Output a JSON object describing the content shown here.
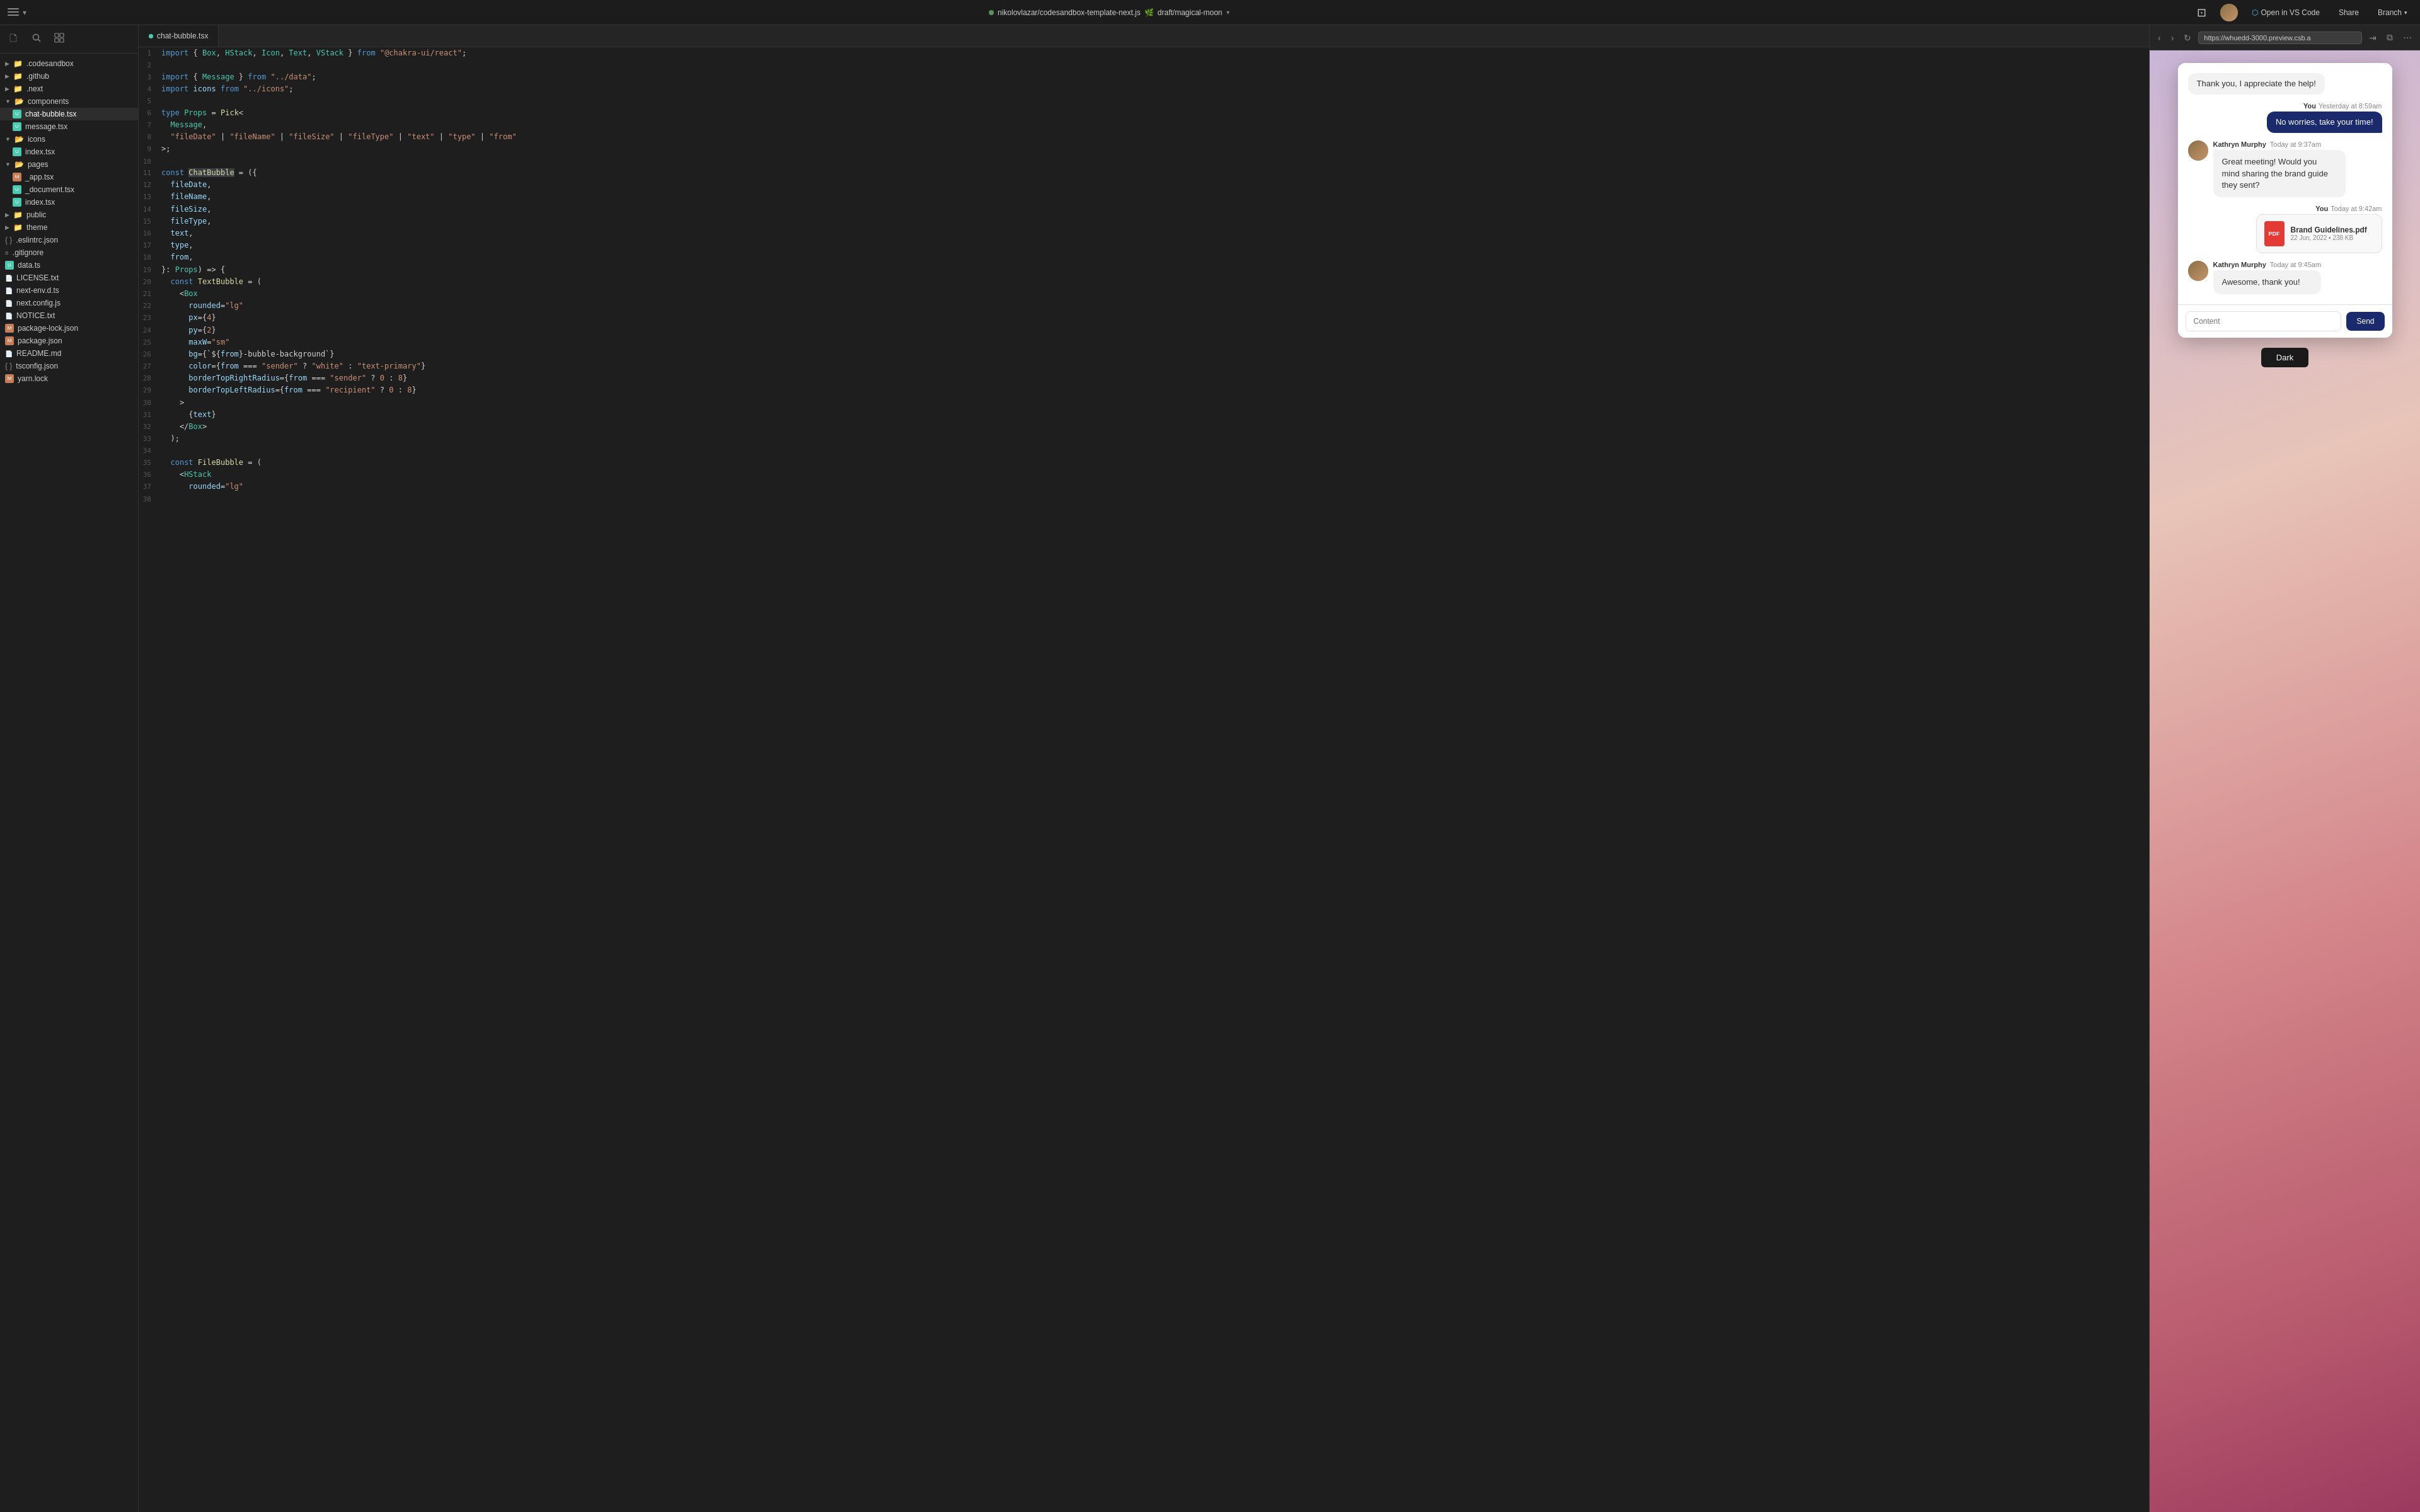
{
  "topbar": {
    "file_name": "nikolovlazar/codesandbox-template-next.js",
    "branch_separator": "🌿",
    "branch_name": "draft/magical-moon",
    "open_vscode_label": "Open in VS Code",
    "share_label": "Share",
    "branch_label": "Branch"
  },
  "sidebar": {
    "items": [
      {
        "id": "codesandbox",
        "label": ".codesandbox",
        "type": "folder",
        "indent": 0
      },
      {
        "id": "github",
        "label": ".github",
        "type": "folder",
        "indent": 0
      },
      {
        "id": "next",
        "label": ".next",
        "type": "folder",
        "indent": 0
      },
      {
        "id": "components",
        "label": "components",
        "type": "folder",
        "indent": 0
      },
      {
        "id": "chat-bubble",
        "label": "chat-bubble.tsx",
        "type": "file-ts",
        "indent": 1
      },
      {
        "id": "message",
        "label": "message.tsx",
        "type": "file-ts",
        "indent": 1
      },
      {
        "id": "icons",
        "label": "icons",
        "type": "folder",
        "indent": 0
      },
      {
        "id": "icons-index",
        "label": "index.tsx",
        "type": "file-ts",
        "indent": 1
      },
      {
        "id": "pages",
        "label": "pages",
        "type": "folder",
        "indent": 0
      },
      {
        "id": "_app",
        "label": "_app.tsx",
        "type": "file-m",
        "indent": 1
      },
      {
        "id": "_document",
        "label": "_document.tsx",
        "type": "file-ts",
        "indent": 1
      },
      {
        "id": "pages-index",
        "label": "index.tsx",
        "type": "file-ts",
        "indent": 1
      },
      {
        "id": "public",
        "label": "public",
        "type": "folder",
        "indent": 0
      },
      {
        "id": "theme",
        "label": "theme",
        "type": "folder",
        "indent": 0
      },
      {
        "id": "eslintrc",
        "label": ".eslintrc.json",
        "type": "file-json",
        "indent": 0
      },
      {
        "id": "gitignore",
        "label": ".gitignore",
        "type": "file-git",
        "indent": 0
      },
      {
        "id": "data",
        "label": "data.ts",
        "type": "file-ts",
        "indent": 0
      },
      {
        "id": "license",
        "label": "LICENSE.txt",
        "type": "file-txt",
        "indent": 0
      },
      {
        "id": "next-env",
        "label": "next-env.d.ts",
        "type": "file-ts",
        "indent": 0
      },
      {
        "id": "next-config",
        "label": "next.config.js",
        "type": "file-js",
        "indent": 0
      },
      {
        "id": "notice",
        "label": "NOTICE.txt",
        "type": "file-txt",
        "indent": 0
      },
      {
        "id": "package-lock",
        "label": "package-lock.json",
        "type": "file-m",
        "indent": 0
      },
      {
        "id": "package",
        "label": "package.json",
        "type": "file-m",
        "indent": 0
      },
      {
        "id": "readme",
        "label": "README.md",
        "type": "file-md",
        "indent": 0
      },
      {
        "id": "tsconfig",
        "label": "tsconfig.json",
        "type": "file-json",
        "indent": 0
      },
      {
        "id": "yarn-lock",
        "label": "yarn.lock",
        "type": "file-m",
        "indent": 0
      }
    ]
  },
  "editor": {
    "tab_name": "chat-bubble.tsx",
    "lines": [
      {
        "num": 1,
        "code": "import { Box, HStack, Icon, Text, VStack } from \"@chakra-ui/react\";"
      },
      {
        "num": 2,
        "code": ""
      },
      {
        "num": 3,
        "code": "import { Message } from \"../data\";"
      },
      {
        "num": 4,
        "code": "import icons from \"../icons\";"
      },
      {
        "num": 5,
        "code": ""
      },
      {
        "num": 6,
        "code": "type Props = Pick<"
      },
      {
        "num": 7,
        "code": "  Message,"
      },
      {
        "num": 8,
        "code": "  \"fileDate\" | \"fileName\" | \"fileSize\" | \"fileType\" | \"text\" | \"type\" | \"from\""
      },
      {
        "num": 9,
        "code": ">;"
      },
      {
        "num": 10,
        "code": ""
      },
      {
        "num": 11,
        "code": "const ChatBubble = ({"
      },
      {
        "num": 12,
        "code": "  fileDate,"
      },
      {
        "num": 13,
        "code": "  fileName,"
      },
      {
        "num": 14,
        "code": "  fileSize,"
      },
      {
        "num": 15,
        "code": "  fileType,"
      },
      {
        "num": 16,
        "code": "  text,"
      },
      {
        "num": 17,
        "code": "  type,"
      },
      {
        "num": 18,
        "code": "  from,"
      },
      {
        "num": 19,
        "code": "}: Props) => {"
      },
      {
        "num": 20,
        "code": "  const TextBubble = ("
      },
      {
        "num": 21,
        "code": "    <Box"
      },
      {
        "num": 22,
        "code": "      rounded=\"lg\""
      },
      {
        "num": 23,
        "code": "      px={4}"
      },
      {
        "num": 24,
        "code": "      py={2}"
      },
      {
        "num": 25,
        "code": "      maxW=\"sm\""
      },
      {
        "num": 26,
        "code": "      bg={`${from}-bubble-background`}"
      },
      {
        "num": 27,
        "code": "      color={from === \"sender\" ? \"white\" : \"text-primary\"}"
      },
      {
        "num": 28,
        "code": "      borderTopRightRadius={from === \"sender\" ? 0 : 8}"
      },
      {
        "num": 29,
        "code": "      borderTopLeftRadius={from === \"recipient\" ? 0 : 8}"
      },
      {
        "num": 30,
        "code": "    >"
      },
      {
        "num": 31,
        "code": "      {text}"
      },
      {
        "num": 32,
        "code": "    </Box>"
      },
      {
        "num": 33,
        "code": "  );"
      },
      {
        "num": 34,
        "code": ""
      },
      {
        "num": 35,
        "code": "  const FileBubble = ("
      },
      {
        "num": 36,
        "code": "    <HStack"
      },
      {
        "num": 37,
        "code": "      rounded=\"lg\""
      },
      {
        "num": 38,
        "code": ""
      }
    ]
  },
  "preview": {
    "url": "https://whuedd-3000.preview.csb.a",
    "chat": {
      "messages": [
        {
          "id": 1,
          "type": "received-no-avatar",
          "text": "Thank you, I appreciate the help!"
        },
        {
          "id": 2,
          "sender": "You",
          "time": "Yesterday at 8:59am",
          "type": "sent",
          "text": "No worries, take your time!"
        },
        {
          "id": 3,
          "sender": "Kathryn Murphy",
          "time": "Today at 9:37am",
          "type": "received",
          "text": "Great meeting! Would you mind sharing the brand guide they sent?"
        },
        {
          "id": 4,
          "sender": "You",
          "time": "Today at 9:42am",
          "type": "sent-file",
          "file_name": "Brand Guidelines.pdf",
          "file_meta": "22 Jun, 2022 • 238 KB"
        },
        {
          "id": 5,
          "sender": "Kathryn Murphy",
          "time": "Today at 9:45am",
          "type": "received",
          "text": "Awesome, thank you!"
        }
      ],
      "input_placeholder": "Content",
      "send_label": "Send"
    },
    "dark_mode_label": "Dark"
  }
}
